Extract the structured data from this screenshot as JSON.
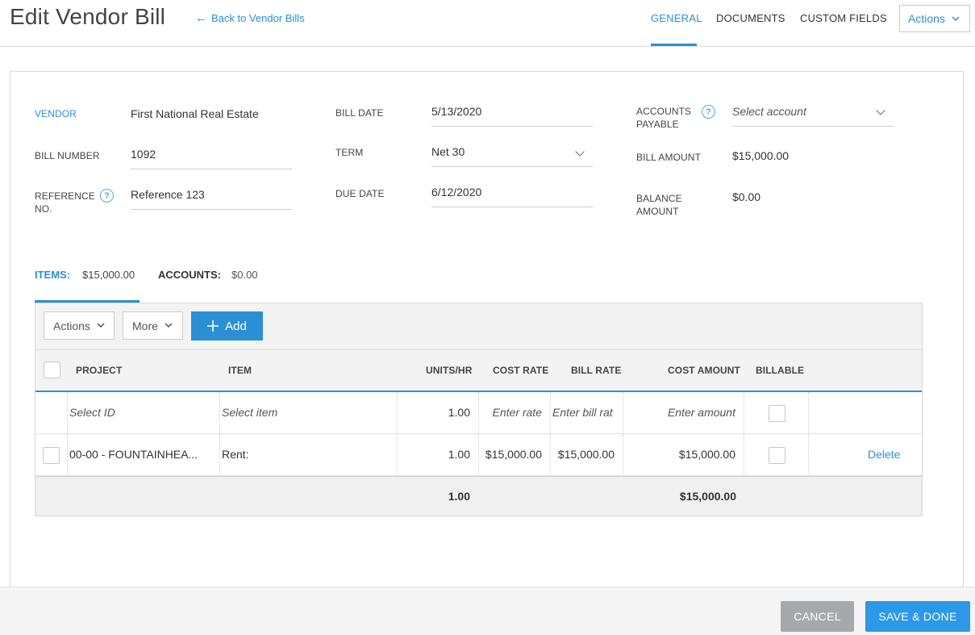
{
  "header": {
    "title": "Edit Vendor Bill",
    "back_link": "Back to Vendor Bills",
    "tabs": [
      "GENERAL",
      "DOCUMENTS",
      "CUSTOM FIELDS"
    ],
    "actions_label": "Actions"
  },
  "form": {
    "vendor_label": "VENDOR",
    "vendor_value": "First National Real Estate",
    "bill_number_label": "BILL NUMBER",
    "bill_number_value": "1092",
    "reference_label_1": "REFERENCE",
    "reference_label_2": "NO.",
    "reference_value": "Reference 123",
    "bill_date_label": "BILL DATE",
    "bill_date_value": "5/13/2020",
    "term_label": "TERM",
    "term_value": "Net 30",
    "due_date_label": "DUE DATE",
    "due_date_value": "6/12/2020",
    "ap_label_1": "ACCOUNTS",
    "ap_label_2": "PAYABLE",
    "ap_placeholder": "Select account",
    "bill_amount_label": "BILL AMOUNT",
    "bill_amount_value": "$15,000.00",
    "balance_label_1": "BALANCE",
    "balance_label_2": "AMOUNT",
    "balance_value": "$0.00",
    "help_glyph": "?"
  },
  "subtabs": {
    "items_label": "ITEMS:",
    "items_amount": "$15,000.00",
    "accounts_label": "ACCOUNTS:",
    "accounts_amount": "$0.00"
  },
  "grid": {
    "actions_label": "Actions",
    "more_label": "More",
    "add_label": "Add",
    "columns": [
      "PROJECT",
      "ITEM",
      "UNITS/HR",
      "COST RATE",
      "BILL RATE",
      "COST AMOUNT",
      "BILLABLE"
    ],
    "new_row": {
      "project": "Select ID",
      "item": "Select item",
      "units": "1.00",
      "cost_rate": "Enter rate",
      "bill_rate": "Enter bill rat",
      "cost_amount": "Enter amount"
    },
    "rows": [
      {
        "project": "00-00 - FOUNTAINHEA...",
        "item": "Rent:",
        "units": "1.00",
        "cost_rate": "$15,000.00",
        "bill_rate": "$15,000.00",
        "cost_amount": "$15,000.00",
        "delete": "Delete"
      }
    ],
    "totals": {
      "units": "1.00",
      "cost_amount": "$15,000.00"
    }
  },
  "footer": {
    "cancel_label": "CANCEL",
    "save_label": "SAVE & DONE"
  },
  "colors": {
    "accent": "#2b8fd6",
    "save_button": "#2b98e8",
    "cancel_button": "#a6a9ac"
  },
  "icons": [
    "arrow-left-icon",
    "chevron-down-icon",
    "help-icon",
    "plus-icon"
  ]
}
